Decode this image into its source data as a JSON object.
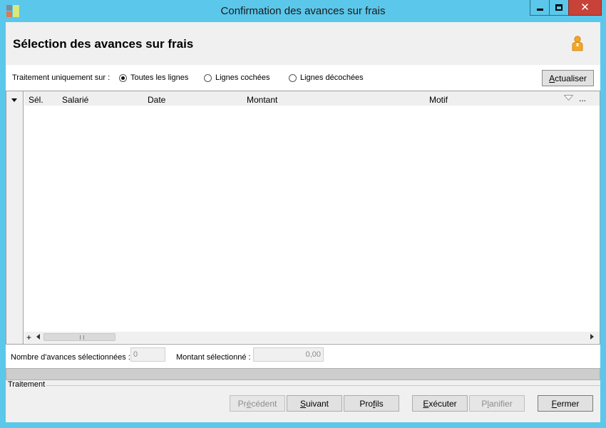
{
  "window": {
    "title": "Confirmation des avances sur frais"
  },
  "header": {
    "title": "Sélection des avances sur frais"
  },
  "filter": {
    "label": "Traitement uniquement sur :",
    "options": [
      {
        "label": "Toutes les lignes",
        "selected": true
      },
      {
        "label": "Lignes cochées",
        "selected": false
      },
      {
        "label": "Lignes décochées",
        "selected": false
      }
    ],
    "refresh": {
      "accel": "A",
      "rest": "ctualiser"
    }
  },
  "grid": {
    "columns": [
      "Sél.",
      "Salarié",
      "Date",
      "Montant",
      "Motif"
    ],
    "more": "...",
    "add": "+",
    "rows": []
  },
  "summary": {
    "count_label": "Nombre d'avances sélectionnées :",
    "count_value": "0",
    "amount_label": "Montant sélectionné :",
    "amount_value": "0,00"
  },
  "progress": {
    "value": 0
  },
  "section": {
    "label": "Traitement"
  },
  "buttons": {
    "previous": {
      "pre": "Pr",
      "accel": "é",
      "post": "cédent"
    },
    "next": {
      "pre": "",
      "accel": "S",
      "post": "uivant"
    },
    "profiles": {
      "pre": "Pro",
      "accel": "f",
      "post": "ils"
    },
    "execute": {
      "pre": "",
      "accel": "E",
      "post": "xécuter"
    },
    "plan": {
      "pre": "P",
      "accel": "l",
      "post": "anifier"
    },
    "close": {
      "pre": "",
      "accel": "F",
      "post": "ermer"
    }
  },
  "colors": {
    "titlebar": "#5bc7ea",
    "close": "#c7433a",
    "progress_fill": "#06b025"
  }
}
